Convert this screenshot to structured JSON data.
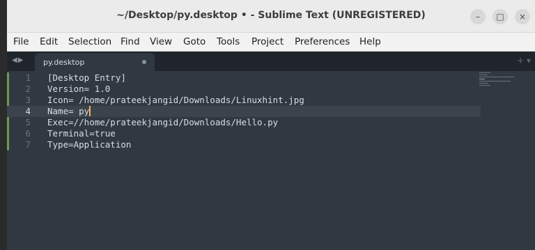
{
  "window": {
    "title": "~/Desktop/py.desktop • - Sublime Text (UNREGISTERED)",
    "minimize": "–",
    "maximize": "□",
    "close": "×"
  },
  "menu": [
    "File",
    "Edit",
    "Selection",
    "Find",
    "View",
    "Goto",
    "Tools",
    "Project",
    "Preferences",
    "Help"
  ],
  "tabbar": {
    "nav": "◀▶",
    "tab_label": "py.desktop",
    "controls": "+ ▾"
  },
  "editor": {
    "current_line": 4,
    "lines": [
      {
        "n": "1",
        "text": "[Desktop Entry]"
      },
      {
        "n": "2",
        "text": "Version= 1.0"
      },
      {
        "n": "3",
        "text": "Icon= /home/prateekjangid/Downloads/Linuxhint.jpg"
      },
      {
        "n": "4",
        "text": "Name= py"
      },
      {
        "n": "5",
        "text": "Exec=//home/prateekjangid/Downloads/Hello.py"
      },
      {
        "n": "6",
        "text": "Terminal=true"
      },
      {
        "n": "7",
        "text": "Type=Application"
      }
    ]
  },
  "colors": {
    "editor_bg": "#303841",
    "caret": "#f9ae58",
    "modified_marker": "#6a9955"
  }
}
